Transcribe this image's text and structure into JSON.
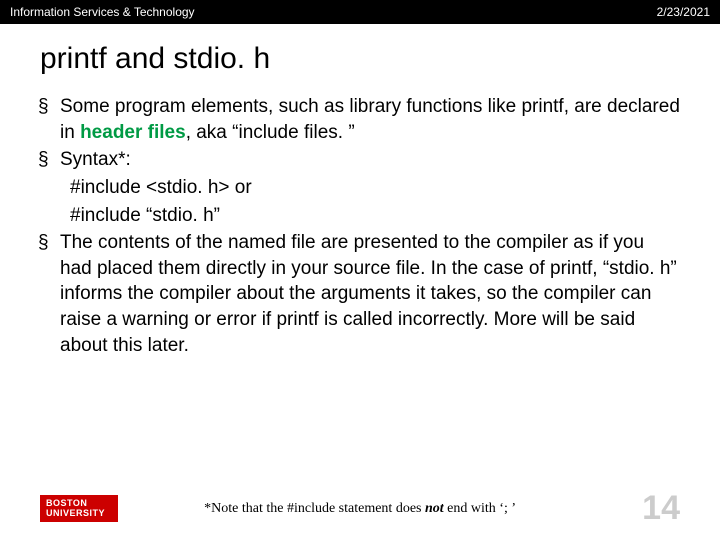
{
  "header": {
    "left": "Information Services & Technology",
    "right": "2/23/2021"
  },
  "title": "printf and stdio. h",
  "bullets": {
    "b1_pre": "Some program elements, such as library functions like printf, are declared in ",
    "b1_bold": "header files",
    "b1_post": ", aka “include files. ”",
    "b2": "Syntax*:",
    "b2_line1": "#include <stdio. h> or",
    "b2_line2": "#include “stdio. h”",
    "b3": "The contents of the named file are presented to the compiler as if you had placed them directly in your source file.  In the case of printf, “stdio. h” informs the compiler about the arguments it takes, so the compiler can raise a warning or error if printf is called incorrectly.  More will be said about this later."
  },
  "footer": {
    "logo_line1": "BOSTON",
    "logo_line2": "UNIVERSITY",
    "note_pre": "*Note that the #include statement does ",
    "note_bold": "not",
    "note_post": " end with ‘; ’",
    "page": "14"
  }
}
